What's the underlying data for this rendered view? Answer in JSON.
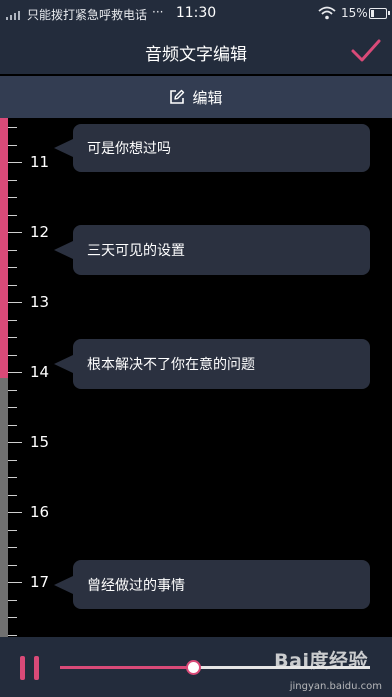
{
  "status_bar": {
    "carrier": "只能拨打紧急呼救电话",
    "more": "···",
    "time": "11:30",
    "battery_percent": "15%",
    "battery_level": 0.15
  },
  "header": {
    "title": "音频文字编辑",
    "confirm_icon": "check-icon"
  },
  "edit_bar": {
    "label": "编辑",
    "icon": "edit-icon"
  },
  "timeline": {
    "ruler_labels": [
      "11",
      "12",
      "13",
      "14",
      "15",
      "16",
      "17"
    ],
    "progress_fraction": 0.5,
    "subtitles": [
      {
        "text": "可是你想过吗"
      },
      {
        "text": "三天可见的设置"
      },
      {
        "text": "根本解决不了你在意的问题"
      },
      {
        "text": "曾经做过的事情"
      }
    ]
  },
  "player": {
    "pause_icon": "pause-icon",
    "progress_fraction": 0.43
  },
  "watermark": {
    "logo": "Bai度经验",
    "url": "jingyan.baidu.com"
  },
  "colors": {
    "accent": "#d94a78",
    "bar_bg": "#232c3c",
    "edit_bar_bg": "#333d52",
    "bubble_bg": "#2b3140"
  }
}
